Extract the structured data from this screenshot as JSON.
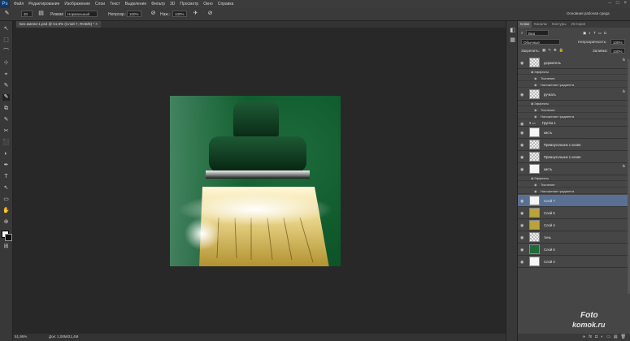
{
  "menubar": {
    "logo": "Ps",
    "items": [
      "Файл",
      "Редактирование",
      "Изображение",
      "Слои",
      "Текст",
      "Выделение",
      "Фильтр",
      "3D",
      "Просмотр",
      "Окно",
      "Справка"
    ],
    "window_controls": [
      "–",
      "□",
      "×"
    ]
  },
  "options": {
    "size_value": "30",
    "mode_label": "Режим:",
    "mode_value": "Нормальный",
    "opacity_label": "Непрозр.:",
    "opacity_value": "100%",
    "flow_label": "Наж.:",
    "flow_value": "100%",
    "workspace": "Основная рабочая среда"
  },
  "document": {
    "tab_title": "Без имени-1.psd @ 51,9% (Слой 7, RGB/8) *",
    "zoom": "51,95%",
    "doc_size": "Док: 1,00М/21,4М"
  },
  "tools": [
    "↖",
    "⬚",
    "⌒",
    "⊹",
    "⌖",
    "✎",
    "✎",
    "⧉",
    "✎",
    "✂",
    "⬛",
    "◐",
    "✒",
    "T",
    "↖",
    "▭",
    "✋",
    "⊕",
    "⊞"
  ],
  "panel": {
    "tabs": [
      "Слои",
      "Каналы",
      "Контуры",
      "История"
    ],
    "active_tab": "Слои",
    "filter_label": "Вид",
    "blend_mode": "Обычные",
    "opacity_label": "Непрозрачность:",
    "opacity_value": "100%",
    "lock_label": "Закрепить:",
    "fill_label": "Заливка:",
    "fill_value": "100%"
  },
  "layers": [
    {
      "name": "держатель",
      "type": "layer",
      "fx": "fx",
      "thumb": "checker",
      "selected": false
    },
    {
      "name": "Эффекты",
      "type": "effects-header"
    },
    {
      "name": "Тиснение",
      "type": "effect"
    },
    {
      "name": "Наложение градиента",
      "type": "effect"
    },
    {
      "name": "ручкать",
      "type": "layer",
      "fx": "fx",
      "thumb": "checker",
      "selected": false
    },
    {
      "name": "Эффекты",
      "type": "effects-header"
    },
    {
      "name": "Тиснение",
      "type": "effect"
    },
    {
      "name": "Наложение градиента",
      "type": "effect"
    },
    {
      "name": "Группа 1",
      "type": "group"
    },
    {
      "name": "кисть",
      "type": "layer",
      "fx": "",
      "thumb": "white",
      "selected": false
    },
    {
      "name": "Прямоугольник 1 копия",
      "type": "layer",
      "fx": "",
      "thumb": "checker",
      "selected": false
    },
    {
      "name": "Прямоугольник 1 копия",
      "type": "layer",
      "fx": "",
      "thumb": "checker",
      "selected": false
    },
    {
      "name": "кисть",
      "type": "layer",
      "fx": "fx",
      "thumb": "white",
      "selected": false
    },
    {
      "name": "Эффекты",
      "type": "effects-header"
    },
    {
      "name": "Тиснение",
      "type": "effect"
    },
    {
      "name": "Наложение градиента",
      "type": "effect"
    },
    {
      "name": "Слой 7",
      "type": "layer",
      "fx": "",
      "thumb": "white",
      "selected": true
    },
    {
      "name": "Слой 5",
      "type": "layer",
      "fx": "",
      "thumb": "yellow",
      "selected": false
    },
    {
      "name": "Слой 4",
      "type": "layer",
      "fx": "",
      "thumb": "yellow",
      "selected": false
    },
    {
      "name": "тень",
      "type": "layer",
      "fx": "",
      "thumb": "checker",
      "selected": false
    },
    {
      "name": "Слой 6",
      "type": "layer",
      "fx": "",
      "thumb": "green",
      "selected": false
    },
    {
      "name": "Слой 3",
      "type": "layer",
      "fx": "",
      "thumb": "white",
      "selected": false
    }
  ],
  "panel_bottom_icons": [
    "∞",
    "fx",
    "◘",
    "◐",
    "▭",
    "▤",
    "🗑"
  ],
  "watermark": {
    "line1": "Foto",
    "line2": "komok.ru"
  }
}
